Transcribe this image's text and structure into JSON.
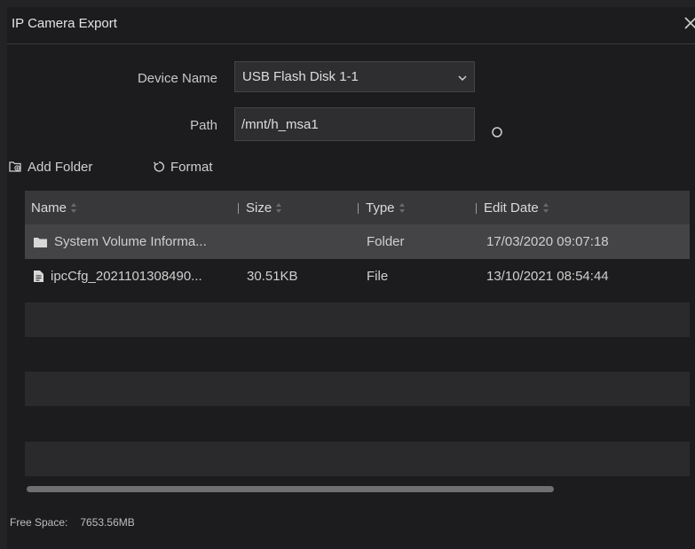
{
  "dialog": {
    "title": "IP Camera Export"
  },
  "form": {
    "device_name_label": "Device Name",
    "device_name_value": "USB Flash Disk 1-1",
    "path_label": "Path",
    "path_value": "/mnt/h_msa1"
  },
  "toolbar": {
    "add_folder_label": "Add Folder",
    "format_label": "Format"
  },
  "table": {
    "headers": {
      "name": "Name",
      "size": "Size",
      "type": "Type",
      "edit_date": "Edit Date"
    },
    "rows": [
      {
        "icon": "folder-icon",
        "name": "System Volume Informa...",
        "size": "",
        "type": "Folder",
        "edit_date": "17/03/2020 09:07:18"
      },
      {
        "icon": "file-icon",
        "name": "ipcCfg_2021101308490...",
        "size": "30.51KB",
        "type": "File",
        "edit_date": "13/10/2021 08:54:44"
      }
    ]
  },
  "footer": {
    "free_space_label": "Free Space:",
    "free_space_value": "7653.56MB"
  },
  "colors": {
    "background": "#1c1c1e",
    "header_row": "#38383a",
    "selected_row": "#444446",
    "stripe_row": "#2a2a2c"
  }
}
